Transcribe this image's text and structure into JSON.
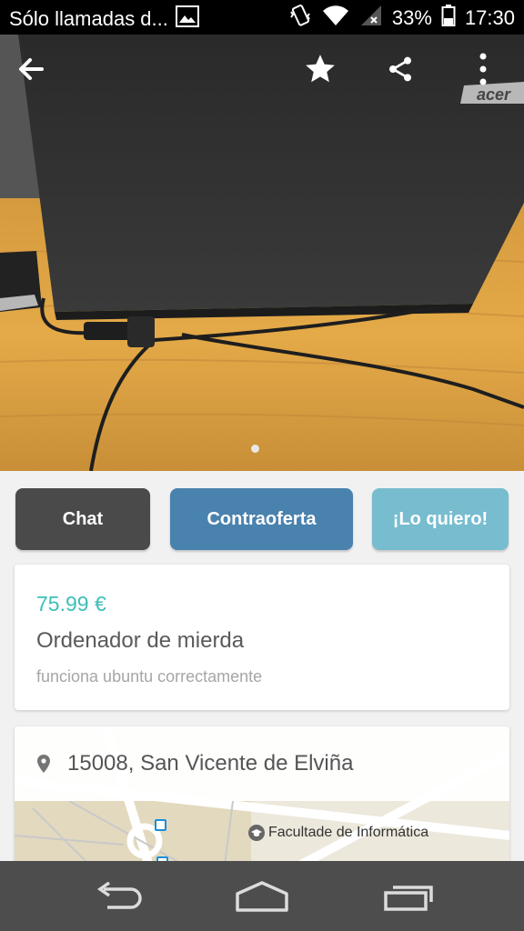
{
  "status_bar": {
    "notification_text": "Sólo llamadas d...",
    "battery_percent": "33%",
    "time": "17:30",
    "icons": [
      "image-icon",
      "vibrate-icon",
      "wifi-icon",
      "signal-icon",
      "battery-icon"
    ]
  },
  "photo_toolbar": {
    "icons": [
      "back-arrow-icon",
      "star-icon",
      "share-icon",
      "more-vert-icon"
    ],
    "brand_label": "acer"
  },
  "actions": {
    "chat_label": "Chat",
    "counteroffer_label": "Contraoferta",
    "want_label": "¡Lo quiero!"
  },
  "product": {
    "price": "75.99 €",
    "title": "Ordenador de mierda",
    "description": "funciona ubuntu correctamente"
  },
  "location": {
    "address": "15008, San Vicente de Elviña",
    "map_poi": "Facultade de Informática"
  },
  "nav_bar": {
    "icons": [
      "nav-back-icon",
      "nav-home-icon",
      "nav-recents-icon"
    ]
  },
  "colors": {
    "price": "#3dbfb8",
    "chat_button": "#4a4a4a",
    "counteroffer_button": "#4a82ae",
    "want_button": "#77bccf"
  }
}
